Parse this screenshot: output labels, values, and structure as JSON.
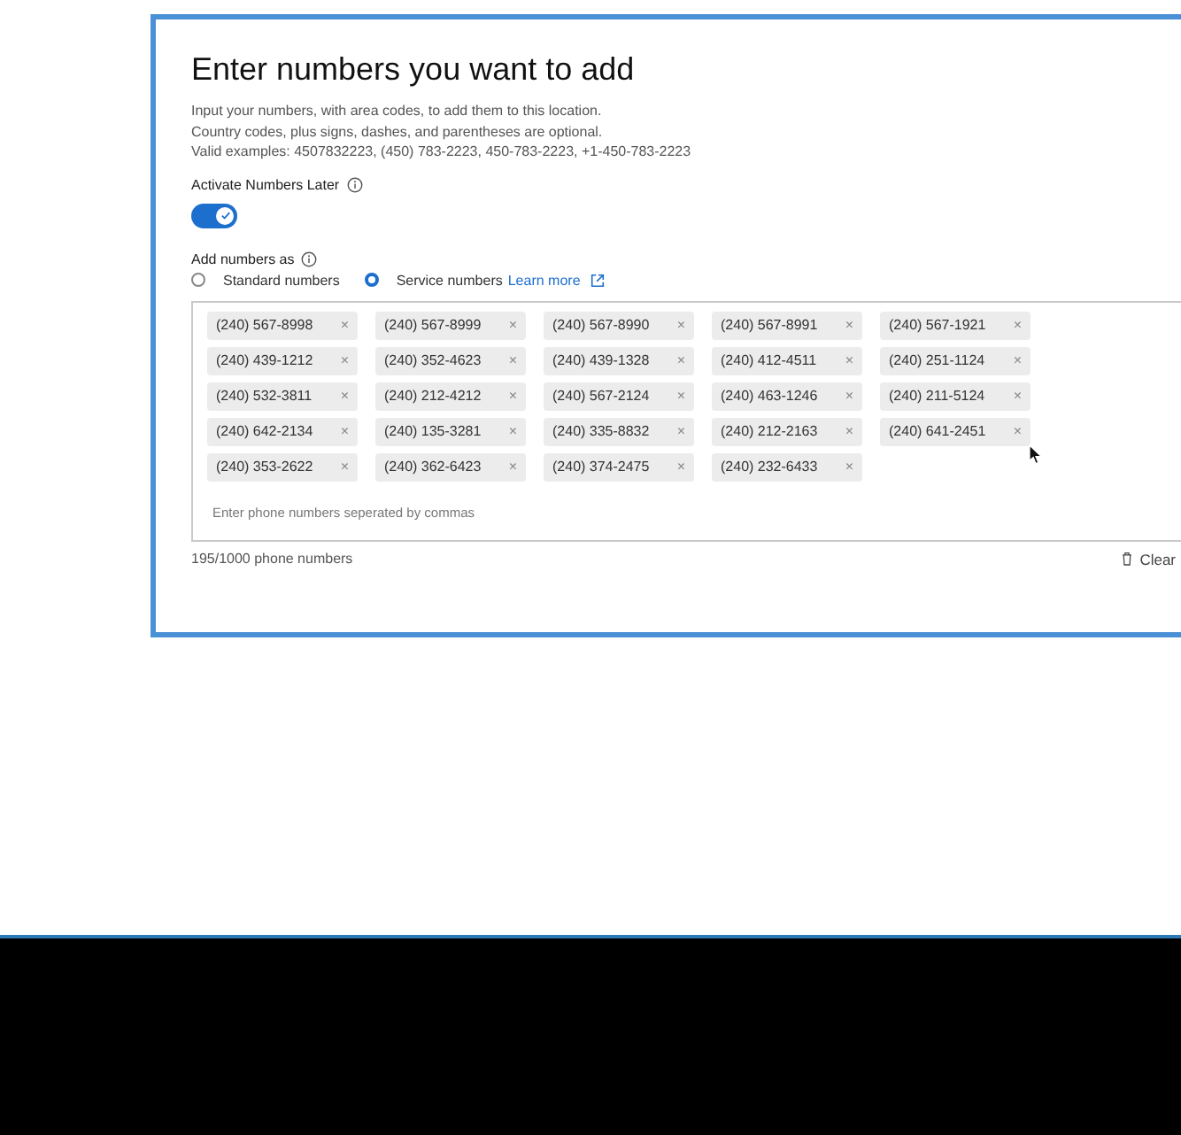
{
  "dialog": {
    "title": "Enter numbers you want to add",
    "instructions": [
      "Input your numbers, with area codes, to add them to this location.",
      "Country codes, plus signs, dashes, and parentheses are optional.",
      "Valid examples: 4507832223, (450) 783-2223, 450-783-2223, +1-450-783-2223"
    ],
    "activate_later": {
      "label": "Activate Numbers Later",
      "on": true
    },
    "add_as": {
      "label": "Add numbers as",
      "options": [
        {
          "label": "Standard numbers",
          "selected": false
        },
        {
          "label": "Service numbers",
          "selected": true,
          "link": "Learn more"
        }
      ]
    },
    "numbers": [
      "(240) 567-8998",
      "(240) 567-8999",
      "(240) 567-8990",
      "(240) 567-8991",
      "(240) 567-1921",
      "(240) 439-1212",
      "(240) 352-4623",
      "(240) 439-1328",
      "(240) 412-4511",
      "(240) 251-1124",
      "(240) 532-3811",
      "(240) 212-4212",
      "(240) 567-2124",
      "(240) 463-1246",
      "(240) 211-5124",
      "(240) 642-2134",
      "(240) 135-3281",
      "(240) 335-8832",
      "(240) 212-2163",
      "(240) 641-2451",
      "(240) 353-2622",
      "(240) 362-6423",
      "(240) 374-2475",
      "(240) 232-6433"
    ],
    "remove_glyph": "×",
    "placeholder": "Enter phone numbers seperated by commas",
    "count": "195/1000 phone numbers",
    "clear": "Clear"
  }
}
